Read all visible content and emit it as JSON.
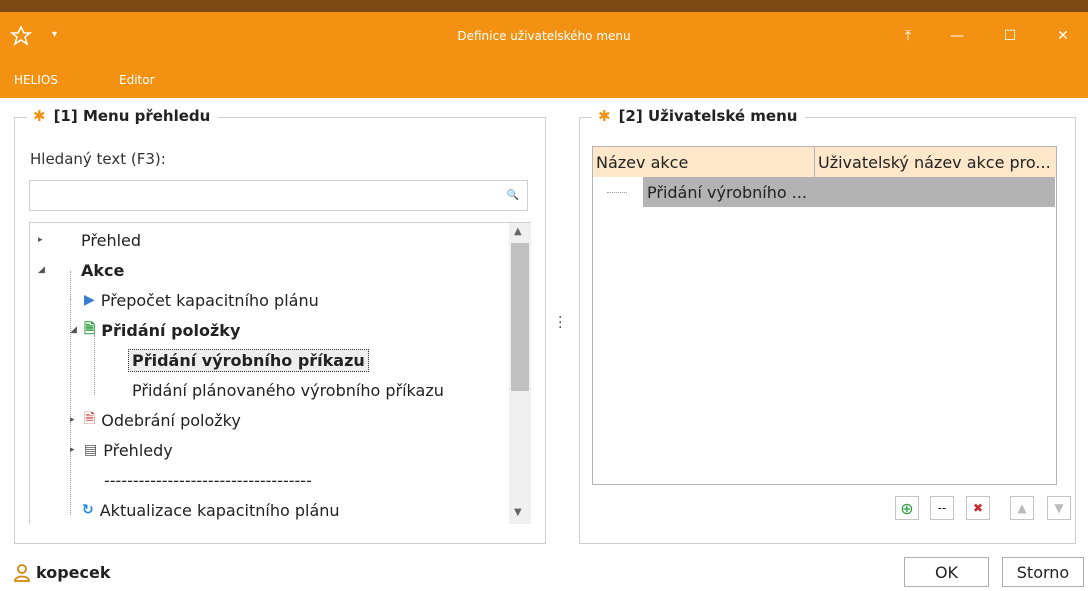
{
  "window": {
    "title": "Definice uživatelského menu",
    "controls": {
      "restore": "⤒",
      "minimize": "—",
      "maximize": "☐",
      "close": "✕"
    },
    "quick_access": "▾"
  },
  "menubar": {
    "items": [
      "HELIOS",
      "Editor"
    ]
  },
  "left_panel": {
    "title": "[1] Menu přehledu",
    "search_label": "Hledaný text (F3):",
    "search_value": "",
    "search_icon": "🔍",
    "tree": [
      {
        "label": "Přehled",
        "level": 0,
        "expander": "▸",
        "bold": false
      },
      {
        "label": "Akce",
        "level": 0,
        "expander": "◢",
        "bold": true
      },
      {
        "label": "Přepočet kapacitního plánu",
        "level": 1,
        "icon": "play-icon",
        "bold": false
      },
      {
        "label": "Přidání položky",
        "level": 1,
        "expander": "◢",
        "icon": "add-doc-icon",
        "bold": true
      },
      {
        "label": "Přidání výrobního příkazu",
        "level": 2,
        "bold": true,
        "selected": true
      },
      {
        "label": "Přidání plánovaného výrobního příkazu",
        "level": 2,
        "bold": false
      },
      {
        "label": "Odebrání položky",
        "level": 1,
        "expander": "▸",
        "icon": "remove-doc-icon",
        "bold": false
      },
      {
        "label": "Přehledy",
        "level": 1,
        "expander": "▸",
        "icon": "list-icon",
        "bold": false
      },
      {
        "label": "------------------------------------",
        "level": 1,
        "bold": false
      },
      {
        "label": "Aktualizace kapacitního plánu",
        "level": 1,
        "icon": "refresh-icon",
        "bold": false
      }
    ]
  },
  "right_panel": {
    "title": "[2] Uživatelské menu",
    "columns": [
      "Název akce",
      "Uživatelský název akce pro..."
    ],
    "rows": [
      {
        "name": "Přidání výrobního ..."
      }
    ],
    "toolbar": {
      "add": "⊕",
      "separator": "--",
      "remove": "✖",
      "up": "▲",
      "down": "▼"
    }
  },
  "footer": {
    "user": "kopecek",
    "ok_label": "OK",
    "cancel_label": "Storno"
  },
  "colors": {
    "accent": "#f39212",
    "header_bg": "#fde7ca",
    "selected_row": "#b3b3b3"
  }
}
